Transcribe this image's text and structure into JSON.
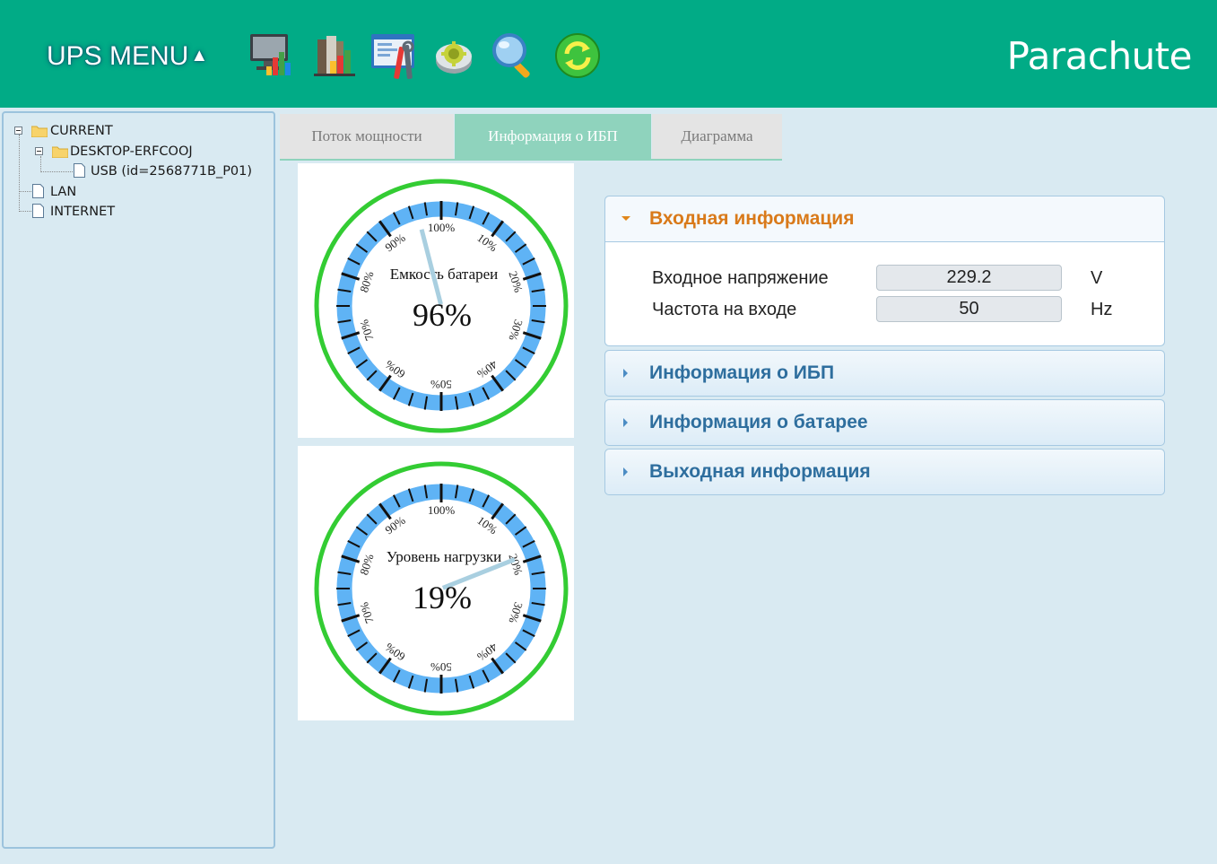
{
  "header": {
    "menu_label": "UPS MENU",
    "menu_arrow": "▲",
    "brand": "Parachute",
    "toolbar_icons": [
      "monitor-chart-icon",
      "books-chart-icon",
      "settings-window-icon",
      "gear-disc-icon",
      "magnifier-icon",
      "refresh-icon"
    ],
    "brand_color": "#01ab86"
  },
  "tree": {
    "root": "CURRENT",
    "host": "DESKTOP-ERFCOOJ",
    "device": "USB (id=2568771B_P01)",
    "lan": "LAN",
    "internet": "INTERNET"
  },
  "tabs": [
    {
      "label": "Поток мощности",
      "active": false
    },
    {
      "label": "Информация о ИБП",
      "active": true
    },
    {
      "label": "Диаграмма",
      "active": false
    }
  ],
  "gauges": [
    {
      "title": "Емкость батареи",
      "value": 96,
      "value_text": "96%",
      "ticks": [
        "100%",
        "10%",
        "20%",
        "30%",
        "40%",
        "50%",
        "60%",
        "70%",
        "80%",
        "90%"
      ]
    },
    {
      "title": "Уровень нагрузки",
      "value": 19,
      "value_text": "19%",
      "ticks": [
        "100%",
        "10%",
        "20%",
        "30%",
        "40%",
        "50%",
        "60%",
        "70%",
        "80%",
        "90%"
      ]
    }
  ],
  "accordion": {
    "input": {
      "title": "Входная информация",
      "rows": [
        {
          "label": "Входное напряжение",
          "value": "229.2",
          "unit": "V"
        },
        {
          "label": "Частота на входе",
          "value": "50",
          "unit": "Hz"
        }
      ]
    },
    "ups_title": "Информация о ИБП",
    "battery_title": "Информация о батарее",
    "output_title": "Выходная информация"
  },
  "colors": {
    "gauge_ring_outer": "#33cc33",
    "gauge_ring_inner": "#5fb3f5",
    "gauge_needle": "#a9cfe0",
    "active_tab": "#8fd3bd",
    "open_section_title": "#d97a1a",
    "section_title": "#2e6e9e"
  }
}
